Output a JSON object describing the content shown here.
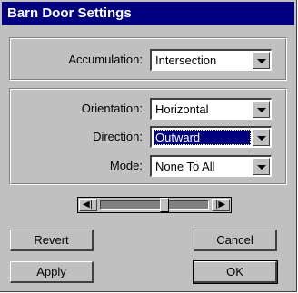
{
  "window": {
    "title": "Barn Door Settings"
  },
  "accumulation": {
    "label": "Accumulation:",
    "value": "Intersection"
  },
  "orientation": {
    "label": "Orientation:",
    "value": "Horizontal"
  },
  "direction": {
    "label": "Direction:",
    "value": "Outward"
  },
  "mode": {
    "label": "Mode:",
    "value": "None To All"
  },
  "slider": {
    "position": 0.6
  },
  "buttons": {
    "revert": "Revert",
    "cancel": "Cancel",
    "apply": "Apply",
    "ok": "OK"
  }
}
